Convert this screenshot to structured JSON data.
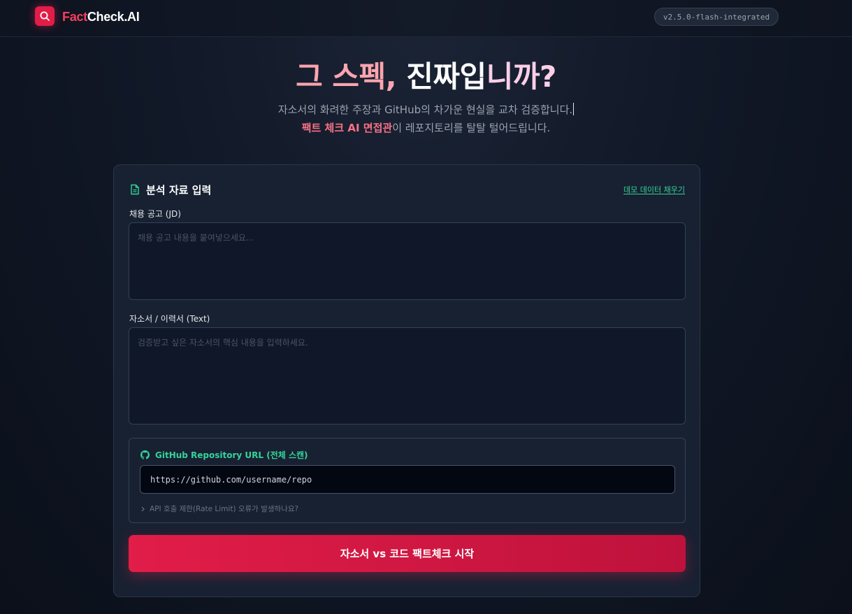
{
  "header": {
    "brand_part1": "Fact",
    "brand_part2": "Check.AI",
    "version": "v2.5.0-flash-integrated"
  },
  "hero": {
    "title_part1": "그 스펙, ",
    "title_part2": "진짜입",
    "title_part3": "니까?",
    "subtitle_line1": "자소서의 화려한 주장과 GitHub의 차가운 현실을 교차 검증합니다.",
    "subtitle_highlight": "팩트 체크 AI 면접관",
    "subtitle_line2_rest": "이 레포지토리를 탈탈 털어드립니다."
  },
  "form": {
    "title": "분석 자료 입력",
    "demo_link": "데모 데이터 채우기",
    "jd_label": "채용 공고 (JD)",
    "jd_placeholder": "채용 공고 내용을 붙여넣으세요...",
    "resume_label": "자소서 / 이력서 (Text)",
    "resume_placeholder": "검증받고 싶은 자소서의 핵심 내용을 입력하세요.",
    "github_label": "GitHub Repository URL (전체 스캔)",
    "github_value": "https://github.com/username/repo",
    "rate_limit_hint": "API 호출 제한(Rate Limit) 오류가 발생하나요?",
    "submit_label": "자소서 vs 코드 팩트체크 시작"
  },
  "icons": {
    "logo": "search-icon",
    "form_title": "document-icon",
    "github": "github-icon",
    "hint": "chevron-right-icon"
  },
  "colors": {
    "accent": "#e11d48",
    "success": "#34d399",
    "background": "#111827",
    "card": "#182132"
  }
}
